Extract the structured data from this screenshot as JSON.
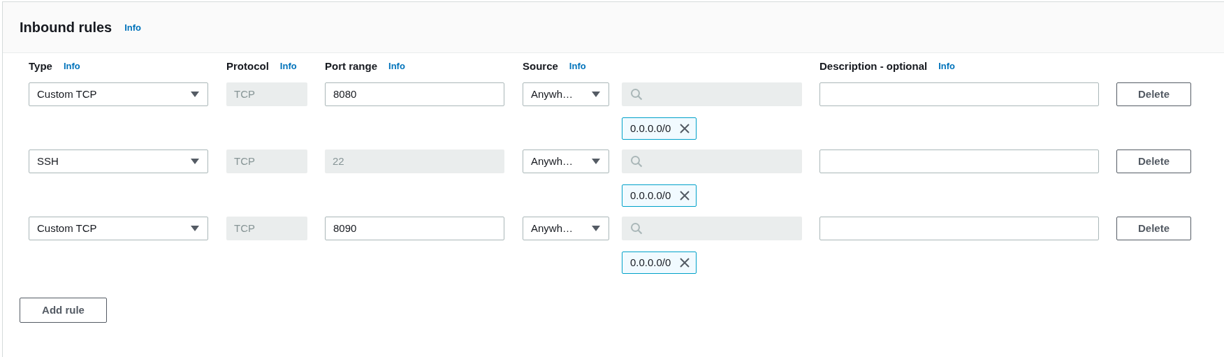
{
  "panel": {
    "title": "Inbound rules",
    "info_link": "Info"
  },
  "columns": [
    {
      "label": "Type",
      "info_link": "Info"
    },
    {
      "label": "Protocol",
      "info_link": "Info"
    },
    {
      "label": "Port range",
      "info_link": "Info"
    },
    {
      "label": "Source",
      "info_link": "Info"
    },
    {
      "label": "Description - optional",
      "info_link": "Info"
    }
  ],
  "rules": [
    {
      "type": "Custom TCP",
      "protocol": "TCP",
      "port_range": {
        "value": "8080",
        "disabled": false
      },
      "source": "Anywh…",
      "cidr_tags": [
        "0.0.0.0/0"
      ],
      "delete_button": "Delete"
    },
    {
      "type": "SSH",
      "protocol": "TCP",
      "port_range": {
        "value": "22",
        "disabled": true
      },
      "source": "Anywh…",
      "cidr_tags": [
        "0.0.0.0/0"
      ],
      "delete_button": "Delete"
    },
    {
      "type": "Custom TCP",
      "protocol": "TCP",
      "port_range": {
        "value": "8090",
        "disabled": false
      },
      "source": "Anywh…",
      "cidr_tags": [
        "0.0.0.0/0"
      ],
      "delete_button": "Delete"
    }
  ],
  "add_rule_button": "Add rule"
}
